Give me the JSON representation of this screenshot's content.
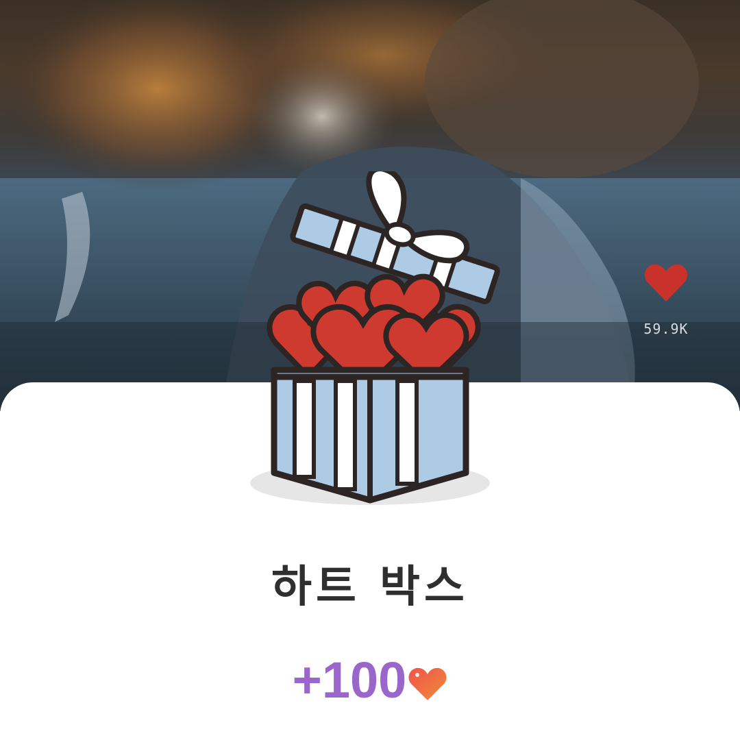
{
  "background": {
    "description_icon": "video-background"
  },
  "like": {
    "icon": "heart-icon",
    "count": "59.9K",
    "color": "#c8322b"
  },
  "reward_sheet": {
    "image_icon": "gift-box-hearts-icon",
    "title": "하트 박스",
    "amount": "+100",
    "amount_color": "#9a66cc",
    "currency_icon": "heart-icon"
  }
}
